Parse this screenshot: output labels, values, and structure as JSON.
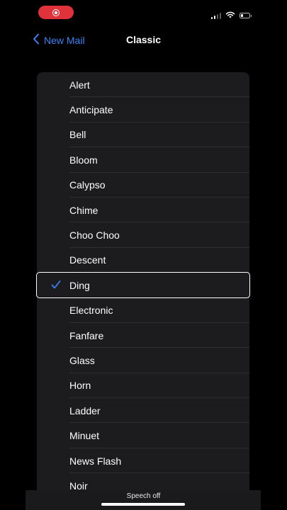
{
  "nav": {
    "back_label": "New Mail",
    "title": "Classic"
  },
  "tones": [
    {
      "label": "Alert",
      "selected": false
    },
    {
      "label": "Anticipate",
      "selected": false
    },
    {
      "label": "Bell",
      "selected": false
    },
    {
      "label": "Bloom",
      "selected": false
    },
    {
      "label": "Calypso",
      "selected": false
    },
    {
      "label": "Chime",
      "selected": false
    },
    {
      "label": "Choo Choo",
      "selected": false
    },
    {
      "label": "Descent",
      "selected": false
    },
    {
      "label": "Ding",
      "selected": true
    },
    {
      "label": "Electronic",
      "selected": false
    },
    {
      "label": "Fanfare",
      "selected": false
    },
    {
      "label": "Glass",
      "selected": false
    },
    {
      "label": "Horn",
      "selected": false
    },
    {
      "label": "Ladder",
      "selected": false
    },
    {
      "label": "Minuet",
      "selected": false
    },
    {
      "label": "News Flash",
      "selected": false
    },
    {
      "label": "Noir",
      "selected": false
    }
  ],
  "footer": {
    "speech_label": "Speech off"
  },
  "icons": {
    "record": "screen-record-icon",
    "signal": "cellular-signal-icon",
    "wifi": "wifi-icon",
    "battery": "battery-icon",
    "back": "chevron-left-icon",
    "check": "checkmark-icon"
  },
  "colors": {
    "accent": "#3a82f7",
    "record": "#e0323a",
    "list_bg": "#1c1c1e"
  }
}
